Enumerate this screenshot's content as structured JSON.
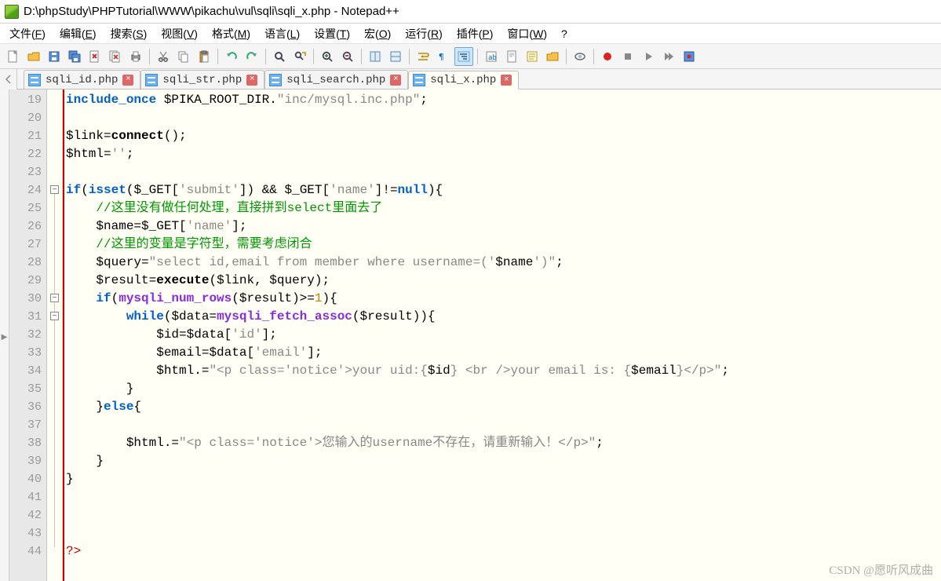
{
  "window": {
    "title": "D:\\phpStudy\\PHPTutorial\\WWW\\pikachu\\vul\\sqli\\sqli_x.php - Notepad++"
  },
  "menu": {
    "items": [
      {
        "label": "文件(F)",
        "u": "F"
      },
      {
        "label": "编辑(E)",
        "u": "E"
      },
      {
        "label": "搜索(S)",
        "u": "S"
      },
      {
        "label": "视图(V)",
        "u": "V"
      },
      {
        "label": "格式(M)",
        "u": "M"
      },
      {
        "label": "语言(L)",
        "u": "L"
      },
      {
        "label": "设置(T)",
        "u": "T"
      },
      {
        "label": "宏(O)",
        "u": "O"
      },
      {
        "label": "运行(R)",
        "u": "R"
      },
      {
        "label": "插件(P)",
        "u": "P"
      },
      {
        "label": "窗口(W)",
        "u": "W"
      },
      {
        "label": "?",
        "u": ""
      }
    ]
  },
  "toolbar": {
    "icons": [
      "new-file",
      "open-file",
      "save",
      "save-all",
      "close",
      "close-all",
      "print",
      "sep",
      "cut",
      "copy",
      "paste",
      "sep",
      "undo",
      "redo",
      "sep",
      "find",
      "replace",
      "sep",
      "zoom-in",
      "zoom-out",
      "sep",
      "sync-v",
      "sync-h",
      "sep",
      "wrap",
      "all-chars",
      "indent-guide",
      "sep",
      "lang",
      "doc-map",
      "func-list",
      "folder",
      "sep",
      "eye",
      "sep",
      "record",
      "stop",
      "play",
      "play-multi",
      "save-macro"
    ]
  },
  "tabs": {
    "items": [
      {
        "label": "sqli_id.php",
        "active": false
      },
      {
        "label": "sqli_str.php",
        "active": false
      },
      {
        "label": "sqli_search.php",
        "active": false
      },
      {
        "label": "sqli_x.php",
        "active": true
      }
    ]
  },
  "editor": {
    "first_line": 19,
    "fold_markers": [
      {
        "line": 24,
        "sym": "-"
      },
      {
        "line": 30,
        "sym": "-"
      },
      {
        "line": 31,
        "sym": "-"
      }
    ],
    "lines": [
      {
        "n": 19,
        "html": "<span class='kw'>include_once</span> <span class='var'>$PIKA_ROOT_DIR</span><span class='op'>.</span><span class='str'>\"inc/mysql.inc.php\"</span><span class='op'>;</span>"
      },
      {
        "n": 20,
        "html": ""
      },
      {
        "n": 21,
        "html": "<span class='var'>$link</span><span class='op'>=</span><span class='fn'>connect</span><span class='op'>();</span>"
      },
      {
        "n": 22,
        "html": "<span class='var'>$html</span><span class='op'>=</span><span class='str'>''</span><span class='op'>;</span>"
      },
      {
        "n": 23,
        "html": ""
      },
      {
        "n": 24,
        "html": "<span class='kw'>if</span><span class='op'>(</span><span class='kw'>isset</span><span class='op'>(</span><span class='var'>$_GET</span><span class='op'>[</span><span class='str'>'submit'</span><span class='op'>])</span> <span class='op'>&amp;&amp;</span> <span class='var'>$_GET</span><span class='op'>[</span><span class='str'>'name'</span><span class='op'>]!=</span><span class='kw'>null</span><span class='op'>){</span>"
      },
      {
        "n": 25,
        "html": "    <span class='cmt'>//这里没有做任何处理，直接拼到select里面去了</span>"
      },
      {
        "n": 26,
        "html": "    <span class='var'>$name</span><span class='op'>=</span><span class='var'>$_GET</span><span class='op'>[</span><span class='str'>'name'</span><span class='op'>];</span>"
      },
      {
        "n": 27,
        "html": "    <span class='cmt'>//这里的变量是字符型，需要考虑闭合</span>"
      },
      {
        "n": 28,
        "html": "    <span class='var'>$query</span><span class='op'>=</span><span class='str'>\"select id,email from member where username=('</span><span class='var'>$name</span><span class='str'>')\"</span><span class='op'>;</span>"
      },
      {
        "n": 29,
        "html": "    <span class='var'>$result</span><span class='op'>=</span><span class='fn'>execute</span><span class='op'>(</span><span class='var'>$link</span><span class='op'>,</span> <span class='var'>$query</span><span class='op'>);</span>"
      },
      {
        "n": 30,
        "html": "    <span class='kw'>if</span><span class='op'>(</span><span class='ident'>mysqli_num_rows</span><span class='op'>(</span><span class='var'>$result</span><span class='op'>)&gt;=</span><span class='num'>1</span><span class='op'>){</span>"
      },
      {
        "n": 31,
        "html": "        <span class='kw'>while</span><span class='op'>(</span><span class='var'>$data</span><span class='op'>=</span><span class='ident'>mysqli_fetch_assoc</span><span class='op'>(</span><span class='var'>$result</span><span class='op'>)){</span>"
      },
      {
        "n": 32,
        "html": "            <span class='var'>$id</span><span class='op'>=</span><span class='var'>$data</span><span class='op'>[</span><span class='str'>'id'</span><span class='op'>];</span>"
      },
      {
        "n": 33,
        "html": "            <span class='var'>$email</span><span class='op'>=</span><span class='var'>$data</span><span class='op'>[</span><span class='str'>'email'</span><span class='op'>];</span>"
      },
      {
        "n": 34,
        "html": "            <span class='var'>$html</span><span class='op'>.=</span><span class='str'>\"&lt;p class='notice'&gt;your uid:{</span><span class='var'>$id</span><span class='str'>} &lt;br /&gt;your email is: {</span><span class='var'>$email</span><span class='str'>}&lt;/p&gt;\"</span><span class='op'>;</span>"
      },
      {
        "n": 35,
        "html": "        <span class='op'>}</span>"
      },
      {
        "n": 36,
        "html": "    <span class='op'>}</span><span class='kw'>else</span><span class='op'>{</span>"
      },
      {
        "n": 37,
        "html": ""
      },
      {
        "n": 38,
        "html": "        <span class='var'>$html</span><span class='op'>.=</span><span class='str'>\"&lt;p class='notice'&gt;您输入的username不存在，请重新输入！&lt;/p&gt;\"</span><span class='op'>;</span>"
      },
      {
        "n": 39,
        "html": "    <span class='op'>}</span>"
      },
      {
        "n": 40,
        "html": "<span class='op'>}</span>"
      },
      {
        "n": 41,
        "html": ""
      },
      {
        "n": 42,
        "html": ""
      },
      {
        "n": 43,
        "html": ""
      },
      {
        "n": 44,
        "html": "<span class='phptag'>?&gt;</span>"
      }
    ]
  },
  "watermark": "CSDN @愿听风成曲"
}
